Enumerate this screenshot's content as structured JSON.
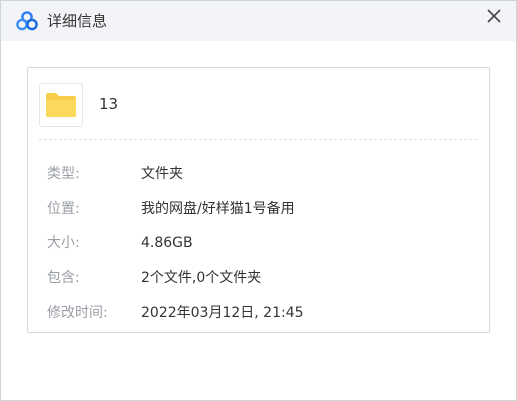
{
  "window": {
    "title": "详细信息",
    "logo_icon": "baidu-netdisk-logo",
    "close_icon": "close-icon"
  },
  "file": {
    "icon": "folder-icon",
    "icon_color": "#f7cf4a",
    "name": "13"
  },
  "details": [
    {
      "label": "类型:",
      "value": "文件夹"
    },
    {
      "label": "位置:",
      "value": "我的网盘/好样猫1号备用"
    },
    {
      "label": "大小:",
      "value": "4.86GB"
    },
    {
      "label": "包含:",
      "value": "2个文件,0个文件夹"
    },
    {
      "label": "修改时间:",
      "value": "2022年03月12日, 21:45"
    }
  ],
  "colors": {
    "logo_blue": "#2f7cf6",
    "label_gray": "#9a9ea5",
    "value_text": "#333333"
  }
}
